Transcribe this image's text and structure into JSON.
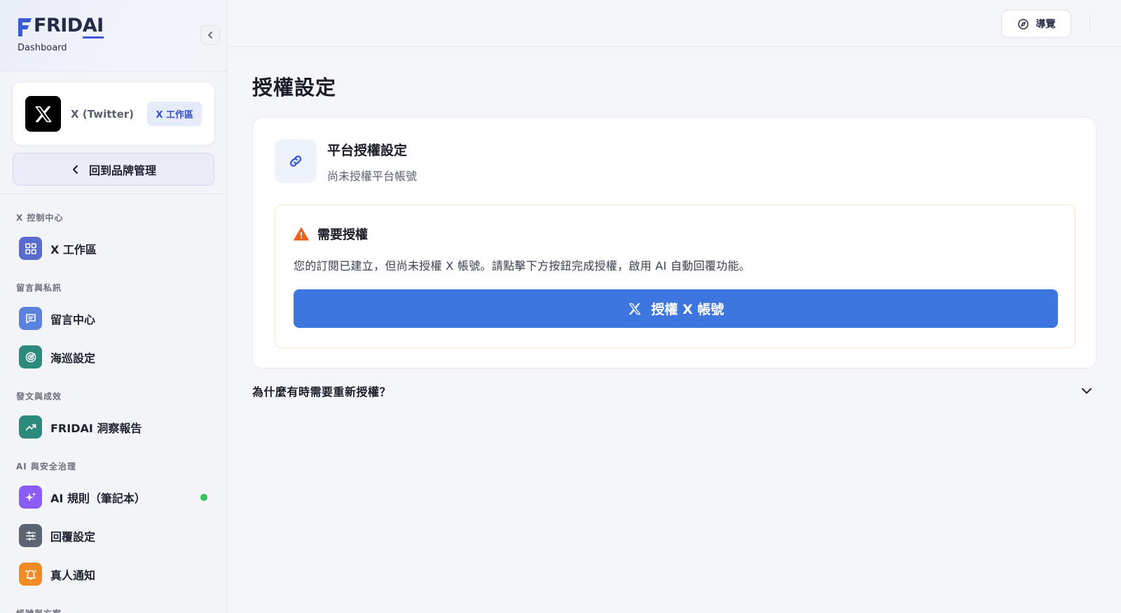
{
  "brand": {
    "logo_text_main": "FRID",
    "logo_text_ai": "AI",
    "subtitle": "Dashboard"
  },
  "platform": {
    "name": "X (Twitter)",
    "workspace_badge": "X 工作區"
  },
  "back_button": {
    "label": "回到品牌管理"
  },
  "nav": {
    "sections": [
      {
        "title": "X 控制中心",
        "items": [
          {
            "label": "X 工作區",
            "icon": "dashboard-grid-icon"
          }
        ]
      },
      {
        "title": "留言與私訊",
        "items": [
          {
            "label": "留言中心",
            "icon": "message-icon"
          },
          {
            "label": "海巡設定",
            "icon": "radar-icon"
          }
        ]
      },
      {
        "title": "發文與成效",
        "items": [
          {
            "label": "FRIDAI 洞察報告",
            "icon": "trend-up-icon"
          }
        ]
      },
      {
        "title": "AI 與安全治理",
        "items": [
          {
            "label": "AI 規則（筆記本）",
            "icon": "sparkles-icon",
            "status": "active"
          },
          {
            "label": "回覆設定",
            "icon": "sliders-icon"
          },
          {
            "label": "真人通知",
            "icon": "bell-icon"
          }
        ]
      },
      {
        "title": "帳號與方案",
        "items": []
      }
    ]
  },
  "topbar": {
    "guide_label": "導覽"
  },
  "main": {
    "page_title": "授權設定",
    "card": {
      "heading": "平台授權設定",
      "subtitle": "尚未授權平台帳號",
      "warning": {
        "title": "需要授權",
        "text": "您的訂閱已建立，但尚未授權 X 帳號。請點擊下方按鈕完成授權，啟用 AI 自動回覆功能。",
        "button_label": "授權 X 帳號"
      }
    },
    "faq": {
      "question": "為什麼有時需要重新授權？"
    }
  },
  "colors": {
    "accent": "#3e76df",
    "brand": "#3b5bd6",
    "warning": "#e8631c",
    "status_online": "#2fc45a"
  }
}
